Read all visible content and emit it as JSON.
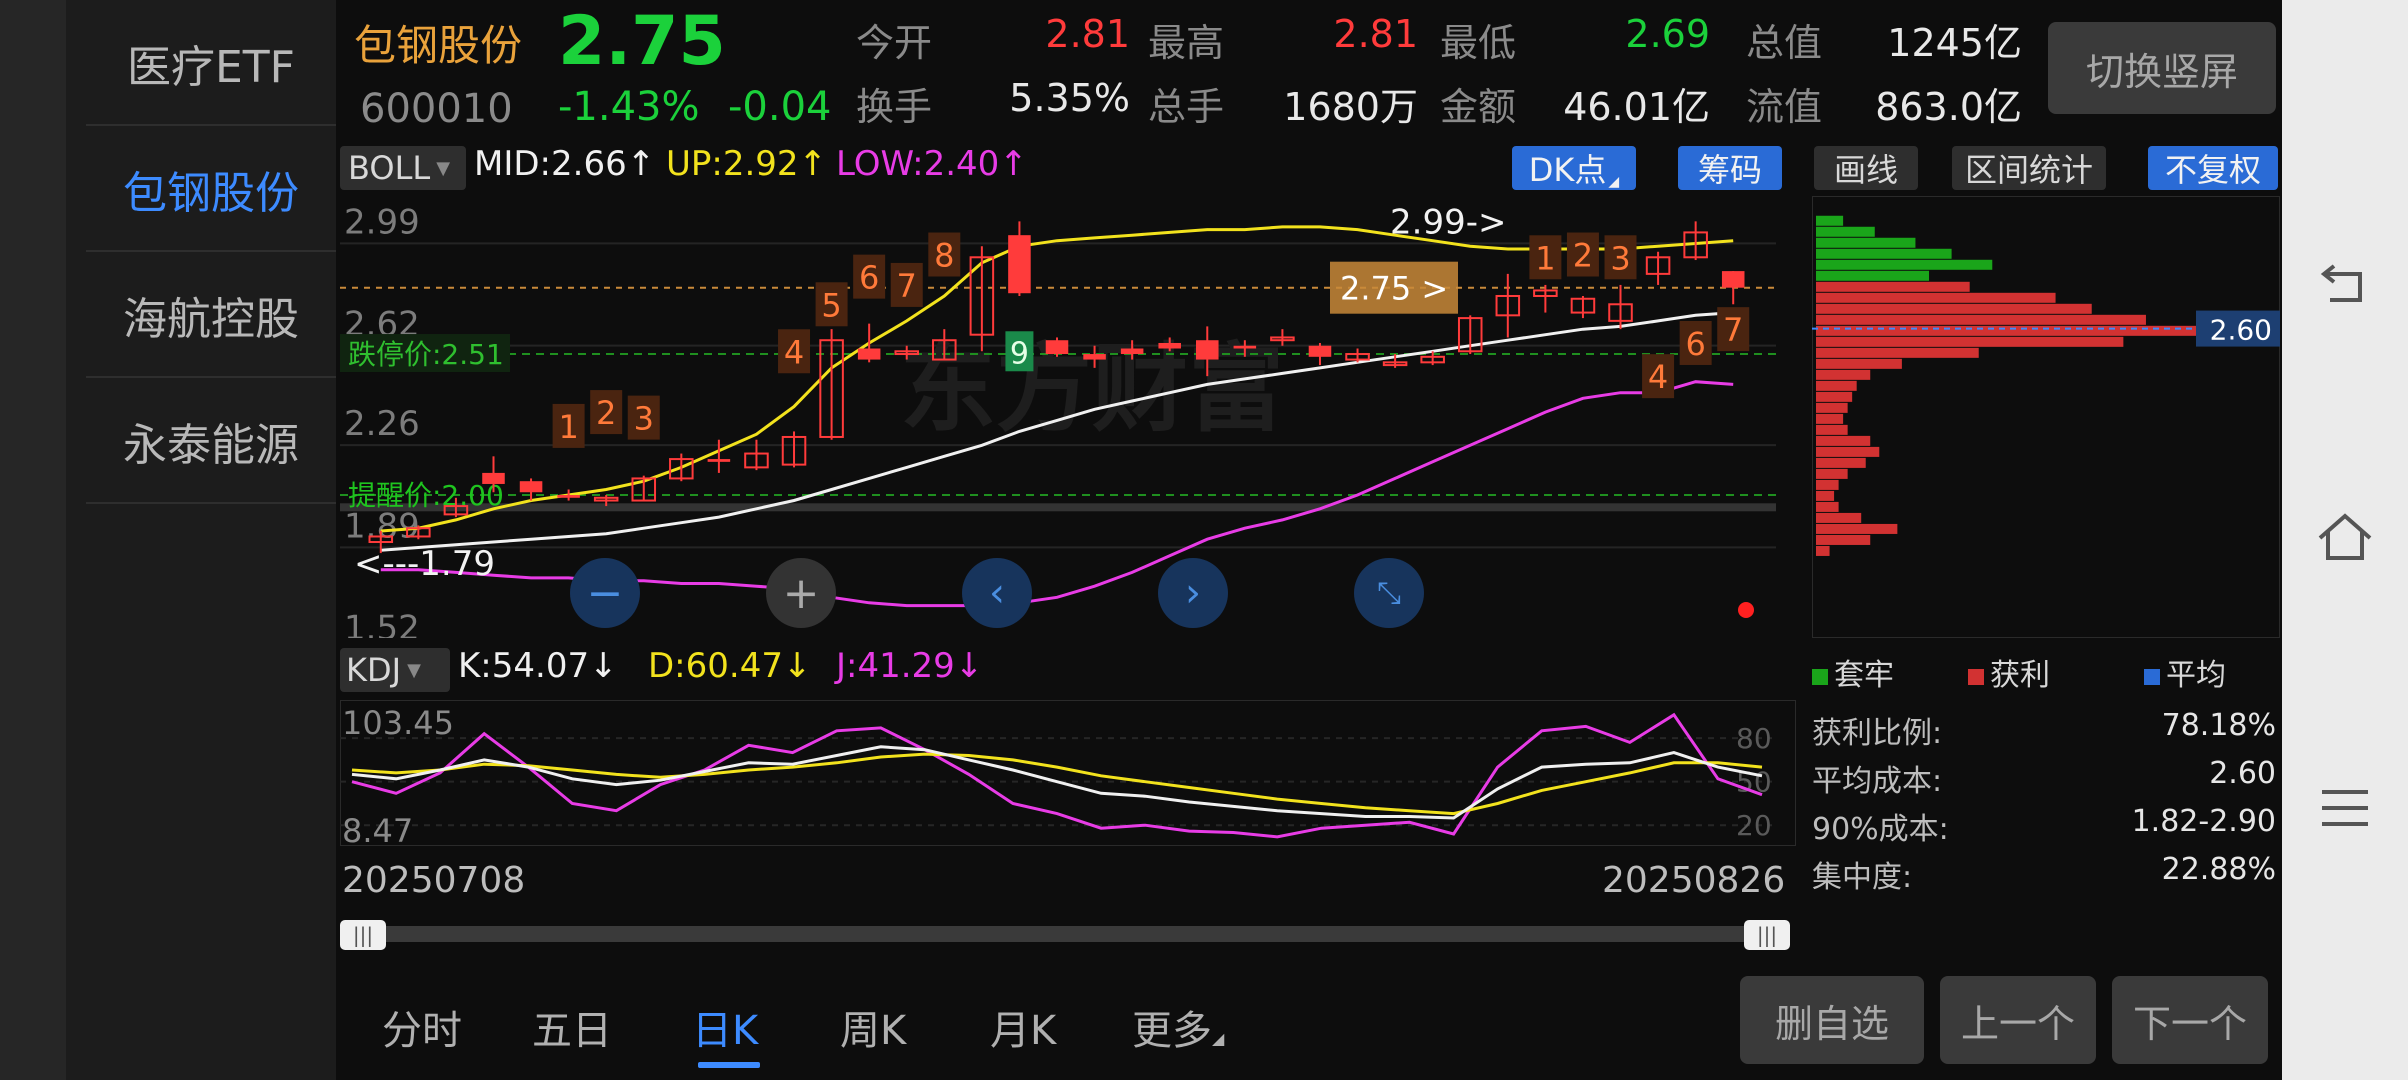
{
  "watchlist": [
    "医疗ETF",
    "包钢股份",
    "海航控股",
    "永泰能源"
  ],
  "header": {
    "name": "包钢股份",
    "code": "600010",
    "price": "2.75",
    "change_pct": "-1.43%",
    "change": "-0.04",
    "fields": [
      {
        "label": "今开",
        "value": "2.81",
        "color": "up"
      },
      {
        "label": "最高",
        "value": "2.81",
        "color": "up"
      },
      {
        "label": "最低",
        "value": "2.69",
        "color": "down"
      },
      {
        "label": "总值",
        "value": "1245亿",
        "color": "white"
      },
      {
        "label": "换手",
        "value": "5.35%",
        "color": "white"
      },
      {
        "label": "总手",
        "value": "1680万",
        "color": "white"
      },
      {
        "label": "金额",
        "value": "46.01亿",
        "color": "white"
      },
      {
        "label": "流值",
        "value": "863.0亿",
        "color": "white"
      }
    ],
    "switch_button": "切换竖屏"
  },
  "boll": {
    "name": "BOLL",
    "mid": "MID:2.66↑",
    "up": "UP:2.92↑",
    "low": "LOW:2.40↑",
    "dk_button": "DK点",
    "chip_button": "筹码",
    "y_labels": [
      "2.99",
      "2.62",
      "2.26",
      "1.89",
      "1.52"
    ],
    "limit_down": "跌停价:2.51",
    "alert": "提醒价:2.00",
    "high_marker": "2.99->",
    "low_marker": "<---1.79",
    "current_marker": "2.75 >",
    "watermark": "东方财富",
    "nine_label": "9"
  },
  "kdj": {
    "name": "KDJ",
    "k": "K:54.07↓",
    "d": "D:60.47↓",
    "j": "J:41.29↓",
    "y_top": "103.45",
    "y_bottom": "8.47",
    "levels": [
      "80",
      "50",
      "20"
    ]
  },
  "dates": {
    "start": "20250708",
    "end": "20250826"
  },
  "chips": {
    "buttons": [
      "画线",
      "区间统计",
      "不复权"
    ],
    "avg_label": "2.60",
    "legend": [
      {
        "name": "套牢",
        "color": "#1aa51a"
      },
      {
        "name": "获利",
        "color": "#d23232"
      },
      {
        "name": "平均",
        "color": "#2a6bd6"
      }
    ],
    "stats": [
      {
        "label": "获利比例:",
        "value": "78.18%"
      },
      {
        "label": "平均成本:",
        "value": "2.60"
      },
      {
        "label": "90%成本:",
        "value": "1.82-2.90"
      },
      {
        "label": "集中度:",
        "value": "22.88%"
      }
    ]
  },
  "bottom": {
    "tabs": [
      "分时",
      "五日",
      "日K",
      "周K",
      "月K",
      "更多"
    ],
    "active_tab": "日K",
    "actions": [
      "删自选",
      "上一个",
      "下一个"
    ]
  },
  "chart_data": {
    "type": "candlestick",
    "price_axis": {
      "labels": [
        2.99,
        2.62,
        2.26,
        1.89,
        1.52
      ]
    },
    "candles": [
      {
        "o": 1.83,
        "h": 1.87,
        "l": 1.79,
        "c": 1.85
      },
      {
        "o": 1.85,
        "h": 1.89,
        "l": 1.84,
        "c": 1.88
      },
      {
        "o": 1.93,
        "h": 1.99,
        "l": 1.92,
        "c": 1.96
      },
      {
        "o": 2.08,
        "h": 2.14,
        "l": 2.01,
        "c": 2.04
      },
      {
        "o": 2.05,
        "h": 2.06,
        "l": 1.98,
        "c": 2.01
      },
      {
        "o": 2.0,
        "h": 2.02,
        "l": 1.98,
        "c": 1.99
      },
      {
        "o": 1.98,
        "h": 2.0,
        "l": 1.96,
        "c": 1.99
      },
      {
        "o": 1.98,
        "h": 2.07,
        "l": 1.98,
        "c": 2.06
      },
      {
        "o": 2.06,
        "h": 2.15,
        "l": 2.05,
        "c": 2.13
      },
      {
        "o": 2.13,
        "h": 2.2,
        "l": 2.08,
        "c": 2.12
      },
      {
        "o": 2.1,
        "h": 2.2,
        "l": 2.09,
        "c": 2.15
      },
      {
        "o": 2.11,
        "h": 2.23,
        "l": 2.1,
        "c": 2.21
      },
      {
        "o": 2.21,
        "h": 2.6,
        "l": 2.2,
        "c": 2.56
      },
      {
        "o": 2.53,
        "h": 2.62,
        "l": 2.48,
        "c": 2.49
      },
      {
        "o": 2.51,
        "h": 2.54,
        "l": 2.49,
        "c": 2.52
      },
      {
        "o": 2.49,
        "h": 2.6,
        "l": 2.49,
        "c": 2.56
      },
      {
        "o": 2.58,
        "h": 2.9,
        "l": 2.52,
        "c": 2.86
      },
      {
        "o": 2.94,
        "h": 2.99,
        "l": 2.72,
        "c": 2.73
      },
      {
        "o": 2.56,
        "h": 2.57,
        "l": 2.5,
        "c": 2.51
      },
      {
        "o": 2.51,
        "h": 2.54,
        "l": 2.46,
        "c": 2.49
      },
      {
        "o": 2.53,
        "h": 2.56,
        "l": 2.49,
        "c": 2.51
      },
      {
        "o": 2.55,
        "h": 2.57,
        "l": 2.52,
        "c": 2.53
      },
      {
        "o": 2.56,
        "h": 2.61,
        "l": 2.43,
        "c": 2.49
      },
      {
        "o": 2.54,
        "h": 2.56,
        "l": 2.5,
        "c": 2.53
      },
      {
        "o": 2.56,
        "h": 2.6,
        "l": 2.54,
        "c": 2.57
      },
      {
        "o": 2.54,
        "h": 2.55,
        "l": 2.47,
        "c": 2.5
      },
      {
        "o": 2.49,
        "h": 2.53,
        "l": 2.48,
        "c": 2.51
      },
      {
        "o": 2.47,
        "h": 2.51,
        "l": 2.46,
        "c": 2.48
      },
      {
        "o": 2.48,
        "h": 2.52,
        "l": 2.47,
        "c": 2.5
      },
      {
        "o": 2.52,
        "h": 2.65,
        "l": 2.51,
        "c": 2.64
      },
      {
        "o": 2.65,
        "h": 2.8,
        "l": 2.57,
        "c": 2.72
      },
      {
        "o": 2.72,
        "h": 2.76,
        "l": 2.66,
        "c": 2.74
      },
      {
        "o": 2.66,
        "h": 2.72,
        "l": 2.64,
        "c": 2.71
      },
      {
        "o": 2.63,
        "h": 2.76,
        "l": 2.6,
        "c": 2.69
      },
      {
        "o": 2.8,
        "h": 2.88,
        "l": 2.76,
        "c": 2.86
      },
      {
        "o": 2.86,
        "h": 2.99,
        "l": 2.85,
        "c": 2.95
      },
      {
        "o": 2.81,
        "h": 2.81,
        "l": 2.69,
        "c": 2.75
      }
    ],
    "mid": [
      1.8,
      1.81,
      1.82,
      1.83,
      1.84,
      1.85,
      1.86,
      1.88,
      1.9,
      1.92,
      1.95,
      1.98,
      2.02,
      2.06,
      2.1,
      2.14,
      2.18,
      2.23,
      2.27,
      2.31,
      2.34,
      2.37,
      2.4,
      2.42,
      2.44,
      2.46,
      2.48,
      2.5,
      2.52,
      2.54,
      2.56,
      2.58,
      2.6,
      2.61,
      2.63,
      2.65,
      2.66
    ],
    "upper": [
      1.87,
      1.88,
      1.91,
      1.95,
      1.98,
      2.0,
      2.02,
      2.05,
      2.1,
      2.16,
      2.22,
      2.32,
      2.46,
      2.55,
      2.63,
      2.72,
      2.84,
      2.9,
      2.92,
      2.93,
      2.94,
      2.95,
      2.96,
      2.96,
      2.97,
      2.97,
      2.96,
      2.94,
      2.92,
      2.9,
      2.89,
      2.89,
      2.89,
      2.89,
      2.9,
      2.91,
      2.92
    ],
    "lower": [
      1.73,
      1.73,
      1.72,
      1.71,
      1.7,
      1.7,
      1.69,
      1.69,
      1.68,
      1.68,
      1.67,
      1.66,
      1.63,
      1.61,
      1.6,
      1.6,
      1.6,
      1.61,
      1.63,
      1.67,
      1.72,
      1.78,
      1.84,
      1.88,
      1.91,
      1.95,
      2.0,
      2.06,
      2.12,
      2.18,
      2.24,
      2.3,
      2.35,
      2.37,
      2.37,
      2.41,
      2.4
    ],
    "kdj": {
      "range": [
        8.47,
        103.45
      ],
      "k": [
        55,
        52,
        58,
        65,
        60,
        52,
        48,
        51,
        57,
        63,
        62,
        68,
        74,
        72,
        65,
        58,
        50,
        42,
        40,
        36,
        33,
        30,
        28,
        26,
        26,
        25,
        45,
        60,
        62,
        63,
        70,
        60,
        54
      ],
      "d": [
        58,
        56,
        58,
        62,
        61,
        58,
        55,
        53,
        55,
        58,
        60,
        63,
        67,
        69,
        68,
        65,
        60,
        54,
        50,
        46,
        42,
        38,
        35,
        32,
        30,
        28,
        35,
        44,
        50,
        56,
        63,
        63,
        60
      ],
      "j": [
        50,
        42,
        56,
        83,
        60,
        35,
        30,
        48,
        58,
        75,
        70,
        85,
        87,
        72,
        55,
        35,
        28,
        18,
        20,
        16,
        15,
        12,
        18,
        20,
        22,
        14,
        60,
        85,
        88,
        77,
        96,
        52,
        41
      ]
    },
    "chips_profile": [
      {
        "price": 2.99,
        "w": 0.06,
        "side": "lock"
      },
      {
        "price": 2.95,
        "w": 0.13,
        "side": "lock"
      },
      {
        "price": 2.91,
        "w": 0.22,
        "side": "lock"
      },
      {
        "price": 2.87,
        "w": 0.3,
        "side": "lock"
      },
      {
        "price": 2.83,
        "w": 0.39,
        "side": "lock"
      },
      {
        "price": 2.79,
        "w": 0.25,
        "side": "lock"
      },
      {
        "price": 2.75,
        "w": 0.34,
        "side": "profit"
      },
      {
        "price": 2.71,
        "w": 0.53,
        "side": "profit"
      },
      {
        "price": 2.67,
        "w": 0.61,
        "side": "profit"
      },
      {
        "price": 2.63,
        "w": 0.73,
        "side": "profit"
      },
      {
        "price": 2.59,
        "w": 0.99,
        "side": "profit"
      },
      {
        "price": 2.55,
        "w": 0.68,
        "side": "profit"
      },
      {
        "price": 2.51,
        "w": 0.36,
        "side": "profit"
      },
      {
        "price": 2.47,
        "w": 0.19,
        "side": "profit"
      },
      {
        "price": 2.43,
        "w": 0.12,
        "side": "profit"
      },
      {
        "price": 2.39,
        "w": 0.09,
        "side": "profit"
      },
      {
        "price": 2.35,
        "w": 0.08,
        "side": "profit"
      },
      {
        "price": 2.31,
        "w": 0.07,
        "side": "profit"
      },
      {
        "price": 2.27,
        "w": 0.06,
        "side": "profit"
      },
      {
        "price": 2.23,
        "w": 0.07,
        "side": "profit"
      },
      {
        "price": 2.19,
        "w": 0.12,
        "side": "profit"
      },
      {
        "price": 2.15,
        "w": 0.14,
        "side": "profit"
      },
      {
        "price": 2.11,
        "w": 0.11,
        "side": "profit"
      },
      {
        "price": 2.07,
        "w": 0.07,
        "side": "profit"
      },
      {
        "price": 2.03,
        "w": 0.05,
        "side": "profit"
      },
      {
        "price": 1.99,
        "w": 0.04,
        "side": "profit"
      },
      {
        "price": 1.95,
        "w": 0.05,
        "side": "profit"
      },
      {
        "price": 1.91,
        "w": 0.1,
        "side": "profit"
      },
      {
        "price": 1.87,
        "w": 0.18,
        "side": "profit"
      },
      {
        "price": 1.83,
        "w": 0.12,
        "side": "profit"
      },
      {
        "price": 1.79,
        "w": 0.03,
        "side": "profit"
      }
    ]
  }
}
